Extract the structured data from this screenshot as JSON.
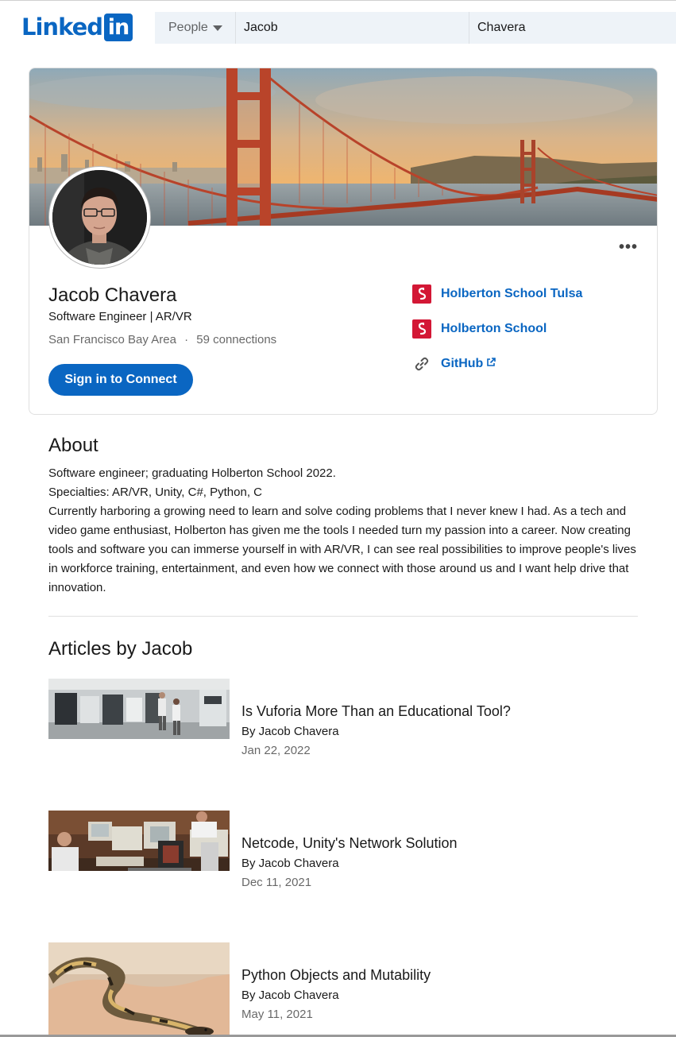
{
  "brand": {
    "logo_text": "Linked",
    "logo_badge": "in",
    "color": "#0a66c2"
  },
  "search": {
    "category": "People",
    "first_name_value": "Jacob",
    "last_name_value": "Chavera"
  },
  "profile": {
    "name": "Jacob Chavera",
    "headline": "Software Engineer | AR/VR",
    "location": "San Francisco Bay Area",
    "separator": "·",
    "connections": "59 connections",
    "connect_label": "Sign in to Connect",
    "more_label": "•••",
    "links": [
      {
        "label": "Holberton School Tulsa",
        "icon": "holberton-school-logo-icon"
      },
      {
        "label": "Holberton School",
        "icon": "holberton-school-logo-icon"
      },
      {
        "label": "GitHub",
        "icon": "link-icon"
      }
    ]
  },
  "about": {
    "title": "About",
    "lines": [
      "Software engineer; graduating Holberton School 2022.",
      "Specialties: AR/VR, Unity, C#, Python, C",
      "Currently harboring a growing need to learn and solve coding problems that I never knew I had. As a tech and video game enthusiast, Holberton has given me the tools I needed turn my passion into a career. Now creating tools and software you can immerse yourself in with AR/VR, I can see real possibilities to improve people's lives in workforce training, entertainment, and even how we connect with those around us and I want help drive that innovation."
    ]
  },
  "articles": {
    "title": "Articles by Jacob",
    "items": [
      {
        "title": "Is Vuforia More Than an Educational Tool?",
        "author": "By Jacob Chavera",
        "date": "Jan 22, 2022"
      },
      {
        "title": "Netcode, Unity's Network Solution",
        "author": "By Jacob Chavera",
        "date": "Dec 11, 2021"
      },
      {
        "title": "Python Objects and Mutability",
        "author": "By Jacob Chavera",
        "date": "May 11, 2021"
      }
    ]
  }
}
